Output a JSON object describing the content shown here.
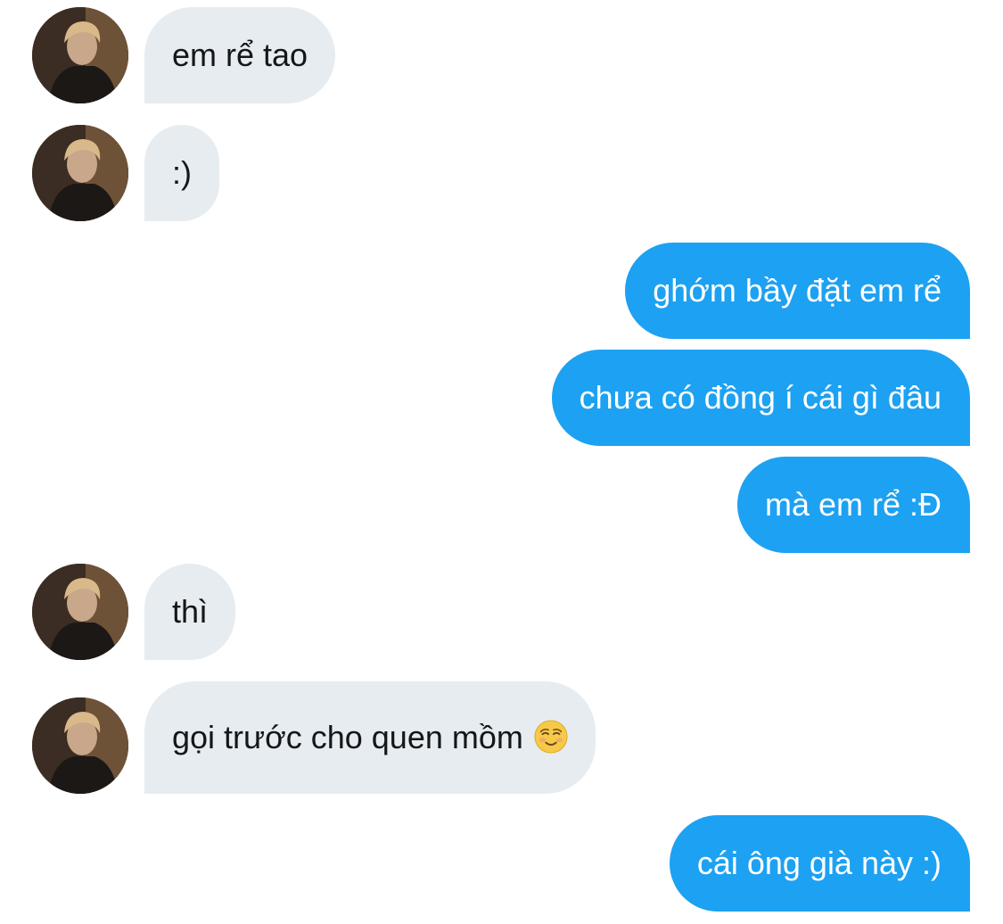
{
  "messages": [
    {
      "sender": "other",
      "text": "em rể tao"
    },
    {
      "sender": "other",
      "text": ":)"
    },
    {
      "sender": "self",
      "text": "ghớm bầy đặt em rể"
    },
    {
      "sender": "self",
      "text": "chưa có đồng í cái gì đâu"
    },
    {
      "sender": "self",
      "text": "mà em rể :Đ"
    },
    {
      "sender": "other",
      "text": "thì"
    },
    {
      "sender": "other",
      "text": "gọi trước cho quen mồm",
      "emoji": "smiling-face-emoji"
    },
    {
      "sender": "self",
      "text": "cái ông già này :)"
    }
  ],
  "colors": {
    "incoming_bubble": "#e6ecf0",
    "incoming_text": "#14171a",
    "outgoing_bubble": "#1da1f2",
    "outgoing_text": "#ffffff"
  }
}
